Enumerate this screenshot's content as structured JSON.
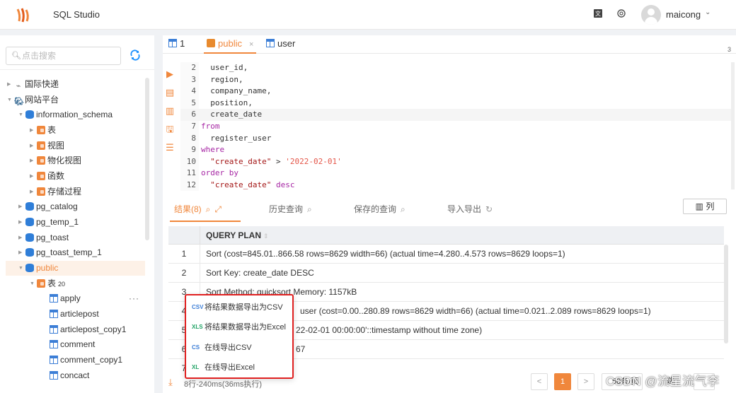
{
  "app": {
    "title": "SQL Studio"
  },
  "topbar": {
    "translate_icon": "translate-icon",
    "settings_icon": "gear-icon",
    "username": "maicong"
  },
  "sidebar": {
    "search_placeholder": "点击搜索",
    "tree": [
      {
        "label": "国际快递",
        "icon": "network-icon"
      },
      {
        "label": "网站平台",
        "icon": "postgres-icon"
      },
      {
        "label": "information_schema",
        "icon": "database-icon"
      },
      {
        "label": "表",
        "icon": "folder-icon"
      },
      {
        "label": "视图",
        "icon": "folder-icon"
      },
      {
        "label": "物化视图",
        "icon": "folder-icon"
      },
      {
        "label": "函数",
        "icon": "folder-icon"
      },
      {
        "label": "存储过程",
        "icon": "folder-icon"
      },
      {
        "label": "pg_catalog",
        "icon": "database-icon"
      },
      {
        "label": "pg_temp_1",
        "icon": "database-icon"
      },
      {
        "label": "pg_toast",
        "icon": "database-icon"
      },
      {
        "label": "pg_toast_temp_1",
        "icon": "database-icon"
      },
      {
        "label": "public",
        "icon": "database-icon"
      },
      {
        "label": "表",
        "icon": "folder-icon",
        "count": "20"
      },
      {
        "label": "apply",
        "icon": "table-icon",
        "more": "···"
      },
      {
        "label": "articlepost",
        "icon": "table-icon"
      },
      {
        "label": "articlepost_copy1",
        "icon": "table-icon"
      },
      {
        "label": "comment",
        "icon": "table-icon"
      },
      {
        "label": "comment_copy1",
        "icon": "table-icon"
      },
      {
        "label": "concact",
        "icon": "table-icon"
      }
    ]
  },
  "tabs": [
    {
      "label": "1"
    },
    {
      "label": "public",
      "close": "×"
    },
    {
      "label": "user"
    }
  ],
  "tab_extra": "3",
  "editor": {
    "lines": [
      {
        "n": "2",
        "text": "  user_id,"
      },
      {
        "n": "3",
        "text": "  region,"
      },
      {
        "n": "4",
        "text": "  company_name,"
      },
      {
        "n": "5",
        "text": "  position,"
      },
      {
        "n": "6",
        "text": "  create_date"
      },
      {
        "n": "7",
        "text": "from"
      },
      {
        "n": "8",
        "text": "  register_user"
      },
      {
        "n": "9",
        "text": "where"
      },
      {
        "n": "10",
        "text_a": "  \"create_date\"",
        "text_b": " > ",
        "text_c": "'2022-02-01'"
      },
      {
        "n": "11",
        "text": "order by"
      },
      {
        "n": "12",
        "text_a": "  \"create_date\"",
        "text_b": " desc"
      }
    ]
  },
  "result_tabs": [
    {
      "label": "结果(8)"
    },
    {
      "label": "历史查询"
    },
    {
      "label": "保存的查询"
    },
    {
      "label": "导入导出"
    }
  ],
  "columns_button": "列",
  "grid": {
    "header": "QUERY PLAN",
    "rows": [
      {
        "n": "1",
        "v": "Sort (cost=845.01..866.58 rows=8629 width=66) (actual time=4.280..4.573 rows=8629 loops=1)"
      },
      {
        "n": "2",
        "v": "Sort Key: create_date DESC"
      },
      {
        "n": "3",
        "v": "Sort Method: quicksort Memory: 1157kB"
      },
      {
        "n": "4",
        "v": "user (cost=0.00..280.89 rows=8629 width=66) (actual time=0.021..2.089 rows=8629 loops=1)"
      },
      {
        "n": "5",
        "v": "22-02-01 00:00:00'::timestamp without time zone)"
      },
      {
        "n": "6",
        "v": "67"
      },
      {
        "n": "7",
        "v": ""
      }
    ]
  },
  "footer": {
    "stat": "8行-240ms(36ms执行)",
    "prev": "<",
    "page": "1",
    "next": ">",
    "page_size": "50条/页",
    "goto": "跳"
  },
  "context_menu": [
    {
      "label": "将结果数据导出为CSV",
      "icon": "csv-icon",
      "tag": "CSV",
      "color": "#3c7ed6"
    },
    {
      "label": "将结果数据导出为Excel",
      "icon": "excel-icon",
      "tag": "XLS",
      "color": "#21a366"
    },
    {
      "label": "在线导出CSV",
      "icon": "csv-online-icon",
      "tag": "CS",
      "color": "#3c7ed6"
    },
    {
      "label": "在线导出Excel",
      "icon": "excel-online-icon",
      "tag": "XL",
      "color": "#21a366"
    }
  ],
  "watermark": "CSDN @流星流气李"
}
